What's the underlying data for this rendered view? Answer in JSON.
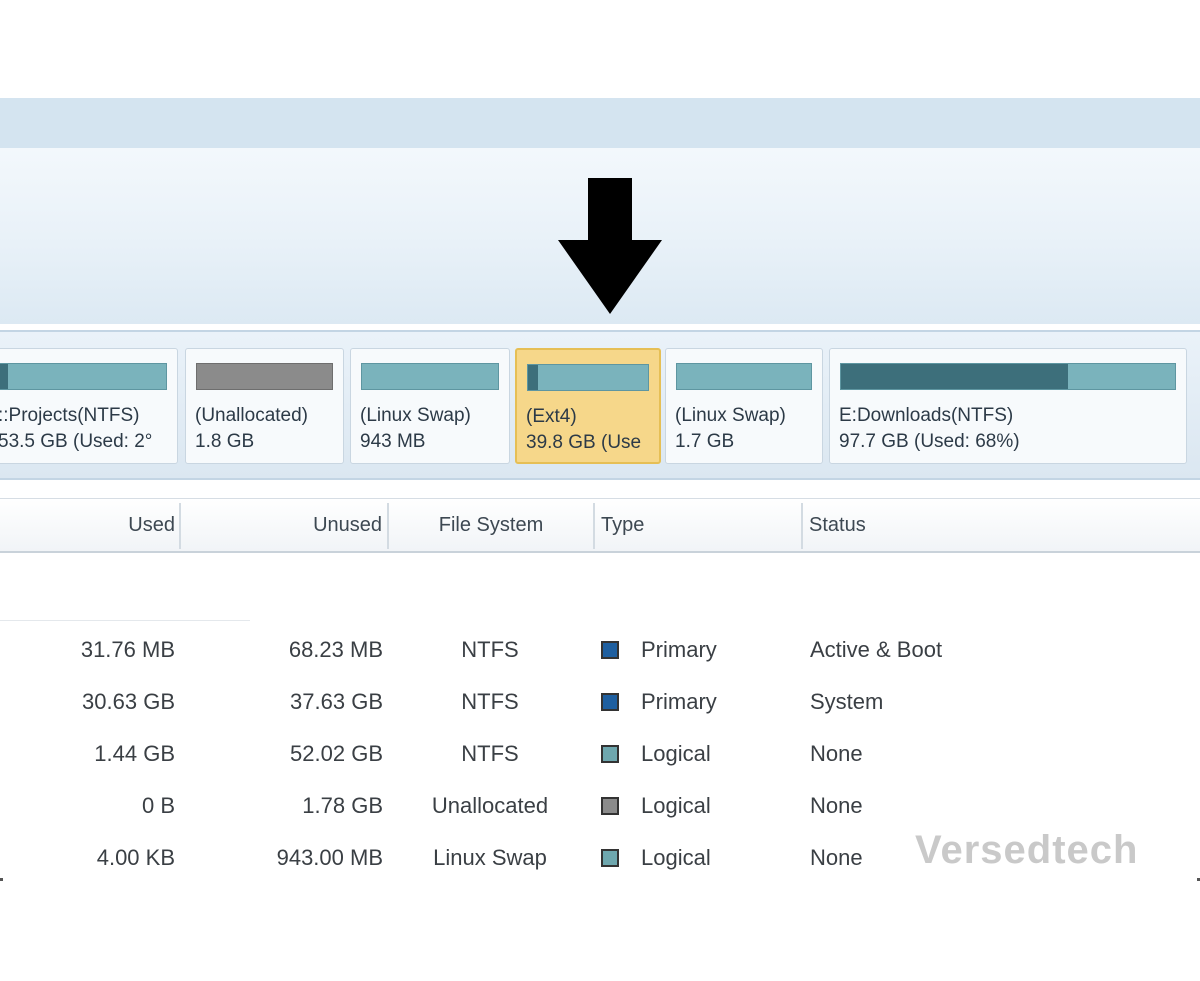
{
  "toolbar": {
    "arrow_icon": "down-arrow-icon"
  },
  "disk_map": {
    "partitions": [
      {
        "name": "::Projects(NTFS)",
        "size": "53.5 GB (Used: 2°",
        "used_fraction": 0.05,
        "bar": "teal",
        "selected": false
      },
      {
        "name": "(Unallocated)",
        "size": "1.8 GB",
        "used_fraction": 0,
        "bar": "gray",
        "selected": false
      },
      {
        "name": "(Linux Swap)",
        "size": "943 MB",
        "used_fraction": 0,
        "bar": "teal",
        "selected": false
      },
      {
        "name": "(Ext4)",
        "size": "39.8 GB (Use",
        "used_fraction": 0.08,
        "bar": "teal",
        "selected": true
      },
      {
        "name": "(Linux Swap)",
        "size": "1.7 GB",
        "used_fraction": 0,
        "bar": "teal",
        "selected": false
      },
      {
        "name": "E:Downloads(NTFS)",
        "size": "97.7 GB (Used: 68%)",
        "used_fraction": 0.68,
        "bar": "teal",
        "selected": false
      }
    ]
  },
  "table": {
    "columns": {
      "used": "Used",
      "unused": "Unused",
      "file_system": "File System",
      "type": "Type",
      "status": "Status"
    },
    "rows": [
      {
        "used": "31.76 MB",
        "unused": "68.23 MB",
        "file_system": "NTFS",
        "type": "Primary",
        "type_color": "#1e5fa0",
        "status": "Active & Boot"
      },
      {
        "used": "30.63 GB",
        "unused": "37.63 GB",
        "file_system": "NTFS",
        "type": "Primary",
        "type_color": "#1e5fa0",
        "status": "System"
      },
      {
        "used": "1.44 GB",
        "unused": "52.02 GB",
        "file_system": "NTFS",
        "type": "Logical",
        "type_color": "#6ea7ae",
        "status": "None"
      },
      {
        "used": "0 B",
        "unused": "1.78 GB",
        "file_system": "Unallocated",
        "type": "Logical",
        "type_color": "#8b8b8b",
        "status": "None"
      },
      {
        "used": "4.00 KB",
        "unused": "943.00 MB",
        "file_system": "Linux Swap",
        "type": "Logical",
        "type_color": "#6ea7ae",
        "status": "None"
      }
    ]
  },
  "watermark": "Versedtech"
}
